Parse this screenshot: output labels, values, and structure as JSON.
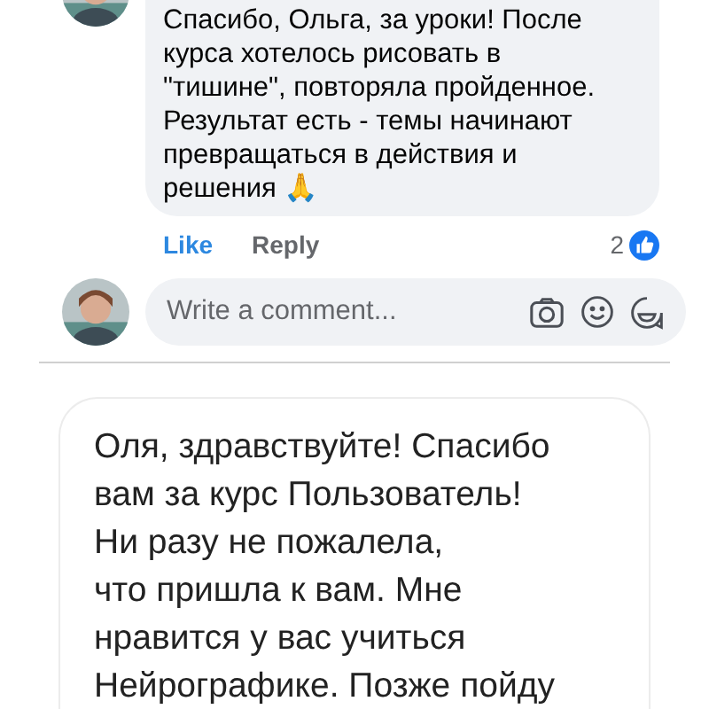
{
  "comment": {
    "lines": [
      "Спасибо, Ольга, за уроки! После",
      "курса хотелось рисовать в",
      "\"тишине\", повторяла пройденное.",
      "Результат есть - темы начинают",
      "превращаться в действия и",
      "решения 🙏"
    ],
    "actions": [
      {
        "label": "Like",
        "selected": true
      },
      {
        "label": "Reply",
        "selected": false
      }
    ],
    "reaction_count": "2"
  },
  "composer": {
    "placeholder": "Write a comment..."
  },
  "card": {
    "lines": [
      "Оля, здравствуйте! Спасибо",
      "вам за курс Пользователь!",
      "Ни разу не пожалела,",
      "что пришла к вам. Мне",
      "нравится у вас учиться",
      "Нейрографике. Позже пойду"
    ]
  }
}
